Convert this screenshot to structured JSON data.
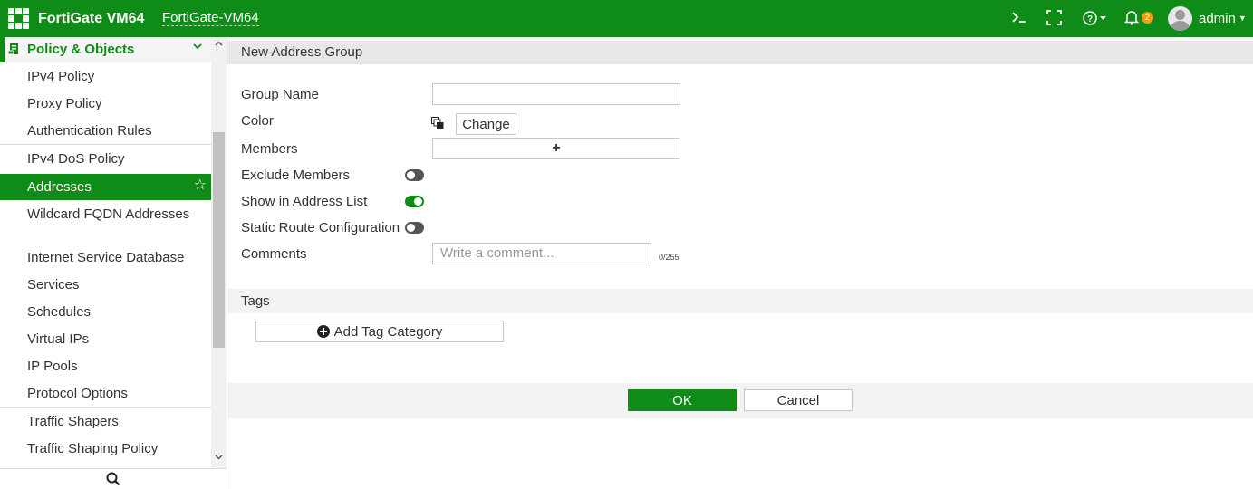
{
  "topbar": {
    "product": "FortiGate VM64",
    "hostname": "FortiGate-VM64",
    "notification_count": "2",
    "user": "admin",
    "icons": [
      "cli-console-icon",
      "fullscreen-icon",
      "help-icon",
      "bell-icon",
      "user-avatar-icon"
    ]
  },
  "sidebar": {
    "section": "Policy & Objects",
    "items": [
      {
        "label": "IPv4 Policy"
      },
      {
        "label": "Proxy Policy"
      },
      {
        "label": "Authentication Rules"
      },
      {
        "label": "IPv4 DoS Policy"
      },
      {
        "label": "Addresses",
        "active": true
      },
      {
        "label": "Wildcard FQDN Addresses"
      },
      {
        "label": "Internet Service Database"
      },
      {
        "label": "Services"
      },
      {
        "label": "Schedules"
      },
      {
        "label": "Virtual IPs"
      },
      {
        "label": "IP Pools"
      },
      {
        "label": "Protocol Options"
      },
      {
        "label": "Traffic Shapers"
      },
      {
        "label": "Traffic Shaping Policy"
      }
    ]
  },
  "form": {
    "title": "New Address Group",
    "group_name_label": "Group Name",
    "group_name_value": "",
    "color_label": "Color",
    "change_label": "Change",
    "members_label": "Members",
    "members_add": "+",
    "exclude_members_label": "Exclude Members",
    "exclude_members_on": false,
    "show_in_list_label": "Show in Address List",
    "show_in_list_on": true,
    "static_route_label": "Static Route Configuration",
    "static_route_on": false,
    "comments_label": "Comments",
    "comments_placeholder": "Write a comment...",
    "comments_counter": "0/255",
    "tags_label": "Tags",
    "add_tag_label": "Add Tag Category",
    "ok_label": "OK",
    "cancel_label": "Cancel"
  },
  "colors": {
    "brand_green": "#0f8c18",
    "badge_orange": "#f39c12"
  }
}
